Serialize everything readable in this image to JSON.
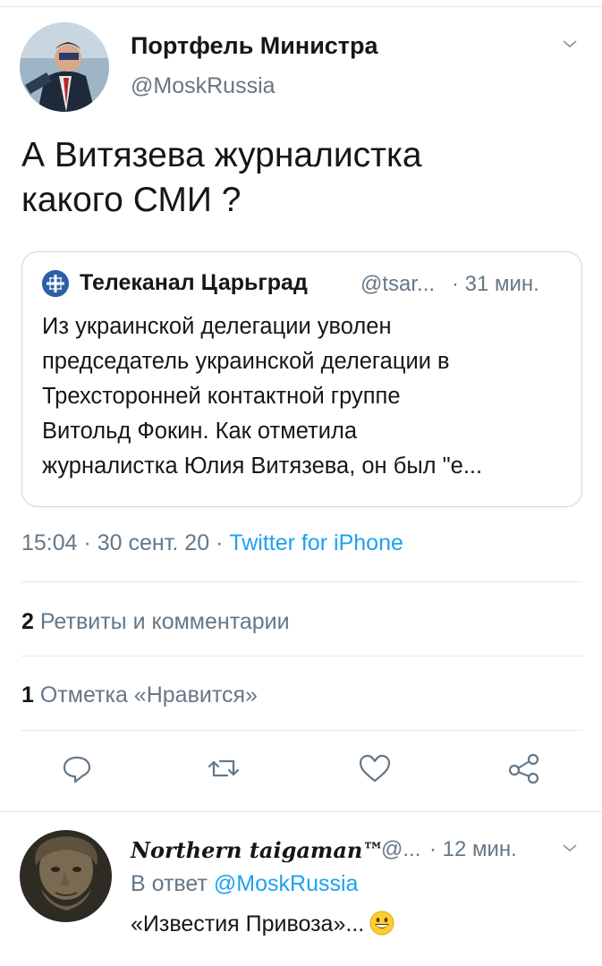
{
  "tweet": {
    "author_name": "Портфель Министра",
    "author_handle": "@MoskRussia",
    "text_line1": "А Витязева журналистка",
    "text_line2": "какого СМИ ?",
    "quote": {
      "name": "Телеканал Царьград",
      "handle": "@tsar...",
      "time": "· 31 мин.",
      "lines": [
        "Из украинской делегации уволен",
        "председатель украинской делегации в",
        "Трехсторонней контактной группе",
        "Витольд Фокин. Как отметила",
        "журналистка Юлия Витязева, он был \"е..."
      ]
    },
    "timestamp": "15:04 · 30 сент. 20 · ",
    "source": "Twitter for iPhone",
    "retweets": {
      "count": "2",
      "label": "Ретвиты и комментарии"
    },
    "likes": {
      "count": "1",
      "label": "Отметка «Нравится»"
    }
  },
  "reply": {
    "author_name": "Northern taigaman™",
    "author_handle": "@...",
    "time": "· 12 мин.",
    "reply_to_prefix": "В ответ ",
    "reply_to_mention": "@MoskRussia",
    "text": "«Известия Привоза»..."
  },
  "icons": [
    "chevron-down-icon",
    "reply-icon",
    "retweet-icon",
    "like-icon",
    "share-icon",
    "smiley-emoji-icon"
  ],
  "colors": {
    "accent": "#1da1f2",
    "secondary_text": "#657786",
    "border": "#e1e8ed"
  }
}
